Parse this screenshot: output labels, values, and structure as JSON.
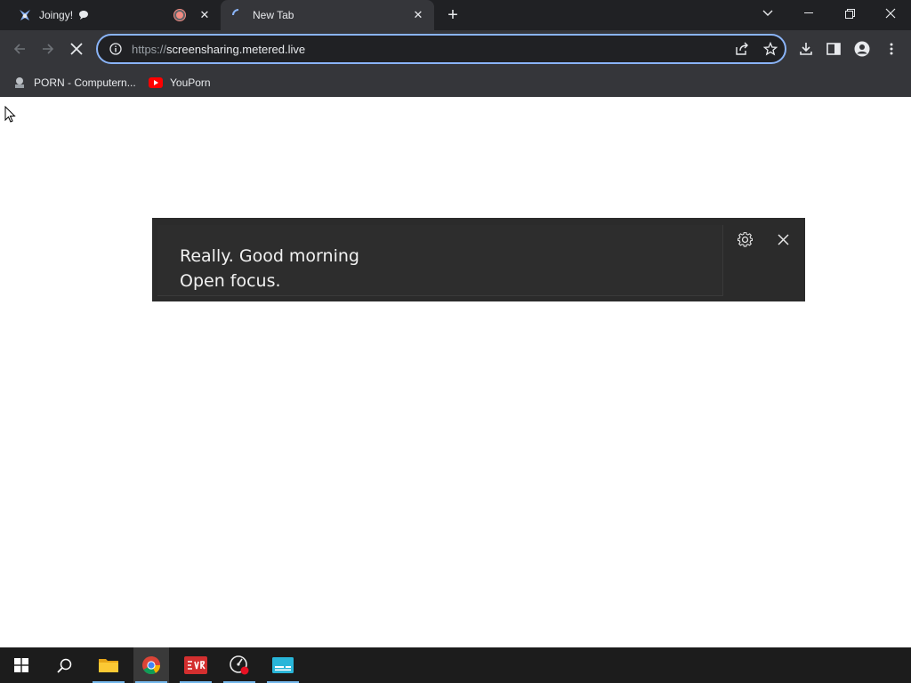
{
  "tabs": [
    {
      "title": "Joingy!",
      "active": false
    },
    {
      "title": "New Tab",
      "active": true
    }
  ],
  "omnibox": {
    "scheme": "https://",
    "host": "screensharing.metered.live"
  },
  "bookmarks": [
    {
      "label": "PORN - Computern..."
    },
    {
      "label": "YouPorn"
    }
  ],
  "notification": {
    "line1": "Really. Good morning",
    "line2": "Open focus."
  },
  "icons": {
    "tab1_favicon": "joingy-icon",
    "tab1_extra": "chat-bubble-icon",
    "tab1_audio": "recording-indicator-icon",
    "tab2_favicon": "loading-spinner-icon",
    "back": "back-arrow-icon",
    "forward": "forward-arrow-icon",
    "stop": "stop-loading-icon",
    "site_info": "info-icon",
    "share": "share-icon",
    "star": "bookmark-star-icon",
    "download": "download-icon",
    "side_panel": "side-panel-icon",
    "profile": "profile-icon",
    "menu": "kebab-menu-icon"
  },
  "colors": {
    "accent": "#8ab4f8",
    "frame": "#202124",
    "toolbar": "#35363a",
    "notification_bg": "#2b2b2b",
    "taskbar": "#1c1c1c"
  }
}
